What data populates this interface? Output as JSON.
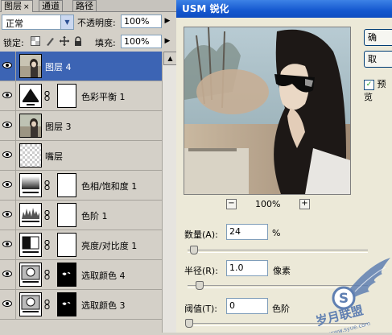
{
  "layers_panel": {
    "tabs": [
      {
        "label": "图层",
        "close": "×"
      },
      {
        "label": "通道"
      },
      {
        "label": "路径"
      }
    ],
    "blend_mode": "正常",
    "opacity_label": "不透明度:",
    "opacity_value": "100%",
    "lock_label": "锁定:",
    "fill_label": "填充:",
    "fill_value": "100%",
    "layers": [
      {
        "name": "图层 4",
        "selected": true,
        "thumb": "photo"
      },
      {
        "name": "色彩平衡 1",
        "thumb": "balance",
        "mask": "white"
      },
      {
        "name": "图层 3",
        "thumb": "photo"
      },
      {
        "name": "嘴层",
        "thumb": "transparent"
      },
      {
        "name": "色相/饱和度 1",
        "thumb": "gradient",
        "mask": "white"
      },
      {
        "name": "色阶 1",
        "thumb": "histogram",
        "mask": "white"
      },
      {
        "name": "亮度/对比度 1",
        "thumb": "brightness",
        "mask": "white"
      },
      {
        "name": "选取颜色 4",
        "thumb": "selective",
        "mask": "black"
      },
      {
        "name": "选取颜色 3",
        "thumb": "selective",
        "mask": "black"
      }
    ]
  },
  "usm_dialog": {
    "title": "USM 锐化",
    "ok_label": "确",
    "cancel_label": "取",
    "preview_label": "预览",
    "preview_checked": true,
    "zoom_out": "−",
    "zoom_in": "+",
    "zoom_level": "100%",
    "amount_label": "数量(A):",
    "amount_value": "24",
    "amount_unit": "%",
    "radius_label": "半径(R):",
    "radius_value": "1.0",
    "radius_unit": "像素",
    "threshold_label": "阈值(T):",
    "threshold_value": "0",
    "threshold_unit": "色阶"
  },
  "watermark": {
    "letter": "S",
    "text": "岁月联盟",
    "url": "www.syue.com"
  },
  "colors": {
    "selected_layer": "#3c64b4",
    "title_bar": "#1457cf",
    "dialog_bg": "#ece9d8",
    "panel_bg": "#d4d0c8",
    "watermark": "#5f7fb2"
  }
}
